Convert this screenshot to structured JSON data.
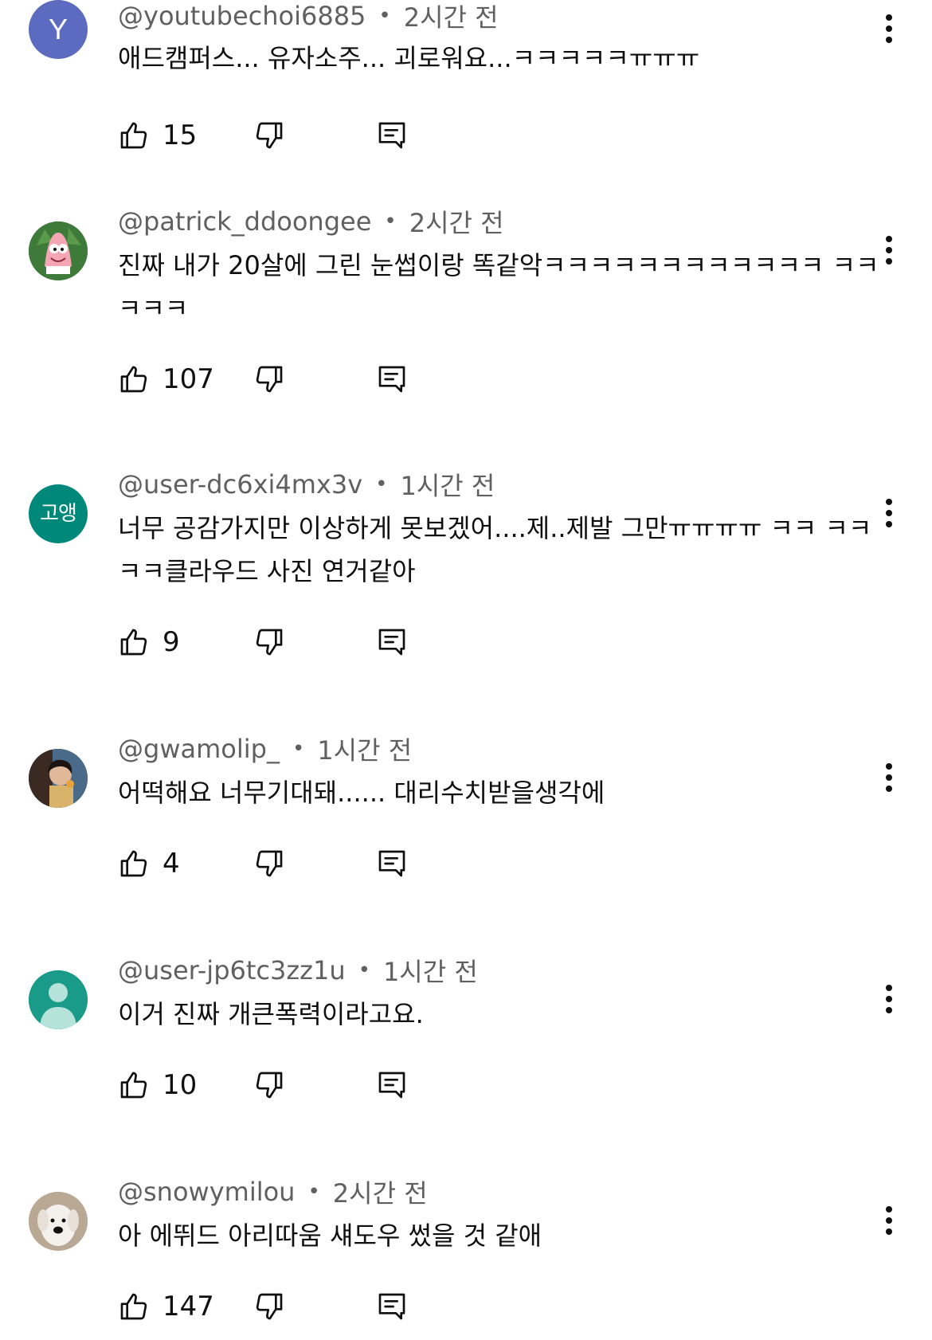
{
  "comments": [
    {
      "avatar": {
        "type": "letter",
        "letter": "Y",
        "color": "#5c6bc0"
      },
      "handle": "@youtubechoi6885",
      "time": "2시간 전",
      "text": "애드캠퍼스... 유자소주... 괴로워요...ㅋㅋㅋㅋㅋㅠㅠㅠ",
      "likes": "15"
    },
    {
      "avatar": {
        "type": "image",
        "description": "patrick-avatar-icon",
        "color": "#3e7a3a"
      },
      "handle": "@patrick_ddoongee",
      "time": "2시간 전",
      "text": "진짜 내가 20살에 그린 눈썹이랑 똑같악ㅋㅋㅋㅋㅋㅋㅋㅋㅋㅋㅋㅋ ㅋㅋㅋㅋㅋ",
      "likes": "107"
    },
    {
      "avatar": {
        "type": "hangul",
        "letter": "고앵",
        "color": "#00897b"
      },
      "handle": "@user-dc6xi4mx3v",
      "time": "1시간 전",
      "text": "너무 공감가지만 이상하게 못보겠어....제..제발 그만ㅠㅠㅠㅠ ㅋㅋ ㅋㅋㅋㅋ클라우드 사진 연거같아",
      "likes": "9"
    },
    {
      "avatar": {
        "type": "image",
        "description": "photo-avatar-icon",
        "color": "#6b4a3a"
      },
      "handle": "@gwamolip_",
      "time": "1시간 전",
      "text": "어떡해요 너무기대돼...... 대리수치받을생각에",
      "likes": "4"
    },
    {
      "avatar": {
        "type": "default",
        "description": "default-user-avatar-icon",
        "color": "#1a9b8a"
      },
      "handle": "@user-jp6tc3zz1u",
      "time": "1시간 전",
      "text": "이거 진짜 개큰폭력이라고요.",
      "likes": "10"
    },
    {
      "avatar": {
        "type": "image",
        "description": "snowy-dog-avatar-icon",
        "color": "#d8cfc2"
      },
      "handle": "@snowymilou",
      "time": "2시간 전",
      "text": "아 에뛰드 아리따움 섀도우 썼을 것 같애",
      "likes": "147"
    }
  ],
  "icons": {
    "like": "thumbs-up-icon",
    "dislike": "thumbs-down-icon",
    "reply": "reply-comment-icon",
    "menu": "more-vertical-icon"
  },
  "colors": {
    "text": "#0f0f0f",
    "secondary_text": "#606060"
  }
}
